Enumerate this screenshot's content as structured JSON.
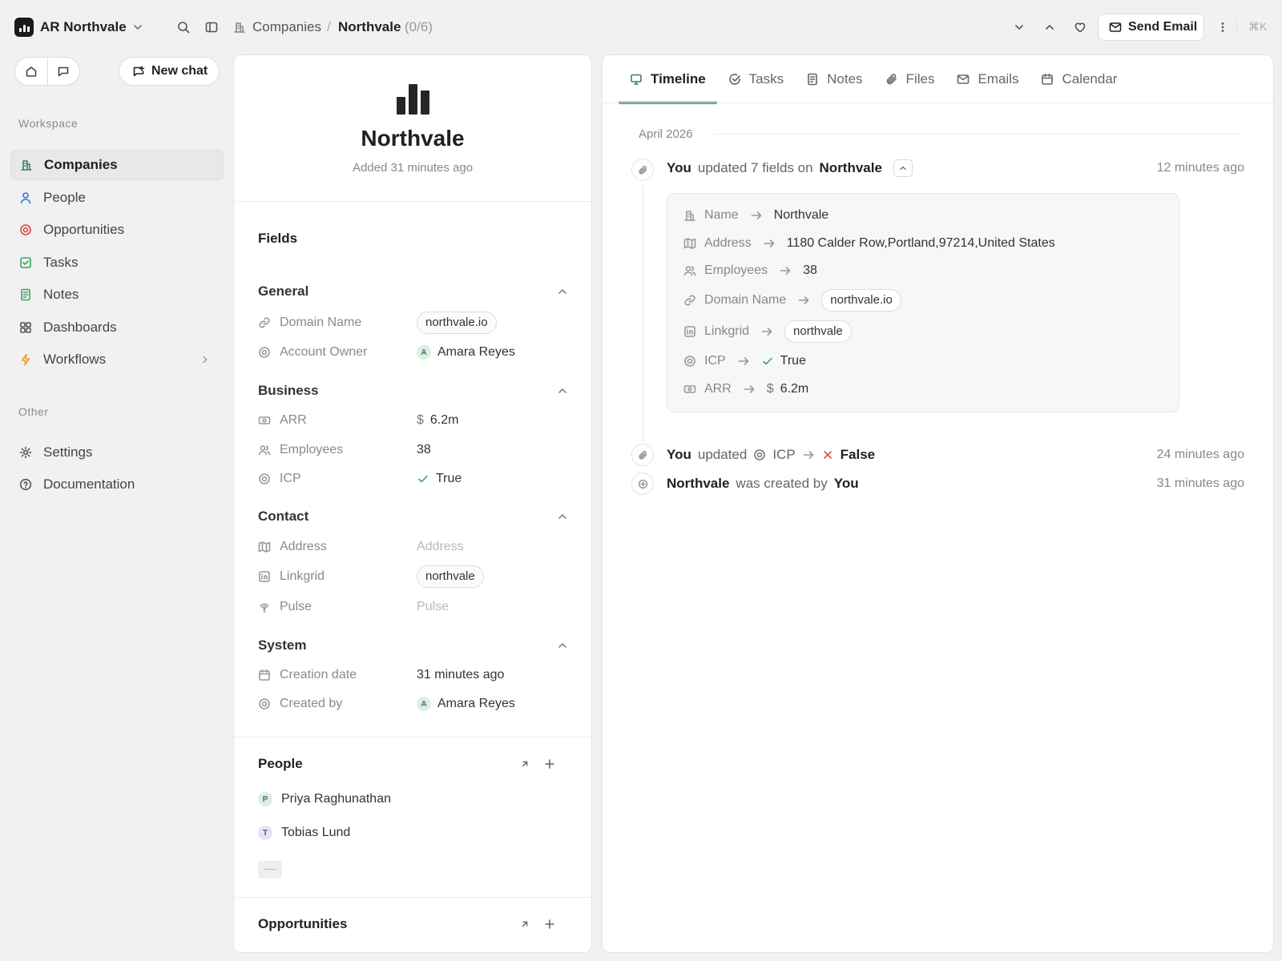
{
  "workspace": {
    "name": "AR Northvale",
    "logo_letters": "AR"
  },
  "breadcrumb": {
    "parent": "Companies",
    "separator": "/",
    "current": "Northvale",
    "count": "(0/6)"
  },
  "topbar": {
    "send_email_label": "Send Email",
    "shortcut": "⌘K"
  },
  "sidebar": {
    "new_chat_label": "New chat",
    "workspace_heading": "Workspace",
    "other_heading": "Other",
    "items": [
      {
        "label": "Companies",
        "icon": "building-icon",
        "color": "#3b7b6b",
        "active": true
      },
      {
        "label": "People",
        "icon": "person-icon",
        "color": "#3b6fd1"
      },
      {
        "label": "Opportunities",
        "icon": "target-icon",
        "color": "#e0453e"
      },
      {
        "label": "Tasks",
        "icon": "checkbox-icon",
        "color": "#3aa35f"
      },
      {
        "label": "Notes",
        "icon": "note-icon",
        "color": "#3aa35f"
      },
      {
        "label": "Dashboards",
        "icon": "grid-icon",
        "color": "#555555"
      },
      {
        "label": "Workflows",
        "icon": "bolt-icon",
        "color": "#f0a030"
      }
    ],
    "other_items": [
      {
        "label": "Settings",
        "icon": "gear-icon"
      },
      {
        "label": "Documentation",
        "icon": "help-icon"
      }
    ]
  },
  "record": {
    "name": "Northvale",
    "added": "Added 31 minutes ago",
    "fields_title": "Fields",
    "groups": {
      "general": {
        "title": "General",
        "domain_label": "Domain Name",
        "domain_value": "northvale.io",
        "owner_label": "Account Owner",
        "owner_value": "Amara Reyes",
        "owner_initial": "A"
      },
      "business": {
        "title": "Business",
        "arr_label": "ARR",
        "arr_currency": "$",
        "arr_value": "6.2m",
        "employees_label": "Employees",
        "employees_value": "38",
        "icp_label": "ICP",
        "icp_value": "True"
      },
      "contact": {
        "title": "Contact",
        "address_label": "Address",
        "address_placeholder": "Address",
        "linkgrid_label": "Linkgrid",
        "linkgrid_value": "northvale",
        "pulse_label": "Pulse",
        "pulse_placeholder": "Pulse"
      },
      "system": {
        "title": "System",
        "created_label": "Creation date",
        "created_value": "31 minutes ago",
        "createdby_label": "Created by",
        "createdby_value": "Amara Reyes",
        "createdby_initial": "A"
      }
    },
    "people": {
      "title": "People",
      "list": [
        {
          "initial": "P",
          "name": "Priya Raghunathan"
        },
        {
          "initial": "T",
          "name": "Tobias Lund"
        }
      ],
      "more": "—"
    },
    "opportunities": {
      "title": "Opportunities"
    }
  },
  "tabs": [
    "Timeline",
    "Tasks",
    "Notes",
    "Files",
    "Emails",
    "Calendar"
  ],
  "timeline": {
    "month": "April 2026",
    "event1": {
      "actor": "You",
      "verb": "updated 7 fields on",
      "target": "Northvale",
      "time": "12 minutes ago",
      "changes": {
        "name_label": "Name",
        "name_value": "Northvale",
        "address_label": "Address",
        "address_value": "1180 Calder Row,Portland,97214,United States",
        "employees_label": "Employees",
        "employees_value": "38",
        "domain_label": "Domain Name",
        "domain_value": "northvale.io",
        "linkgrid_label": "Linkgrid",
        "linkgrid_value": "northvale",
        "icp_label": "ICP",
        "icp_value": "True",
        "arr_label": "ARR",
        "arr_currency": "$",
        "arr_value": "6.2m"
      }
    },
    "event2": {
      "actor": "You",
      "verb": "updated",
      "field": "ICP",
      "value": "False",
      "time": "24 minutes ago"
    },
    "event3": {
      "subject": "Northvale",
      "verb": "was created by",
      "actor": "You",
      "time": "31 minutes ago"
    }
  }
}
